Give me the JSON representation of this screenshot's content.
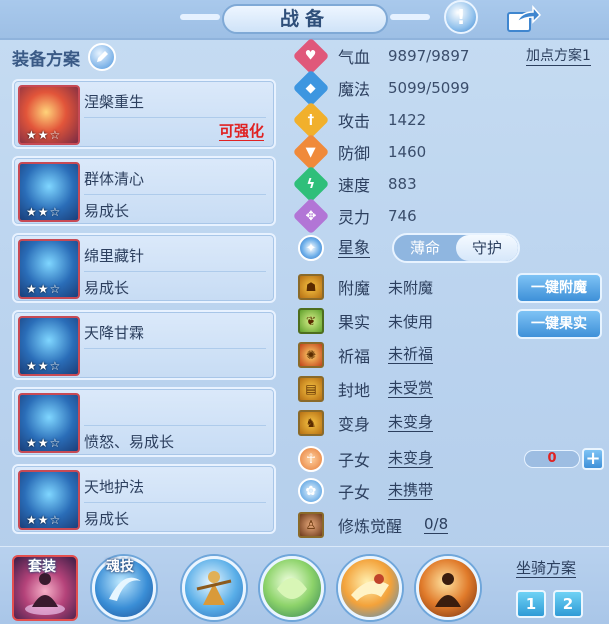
{
  "header": {
    "title": "战备",
    "info_glyph": "!",
    "share_icon": "share-icon"
  },
  "left": {
    "heading": "装备方案",
    "equipment": [
      {
        "name": "涅槃重生",
        "trait": "",
        "strength_label": "可强化",
        "stars": "★★☆",
        "icon": "rocket-item-icon"
      },
      {
        "name": "群体清心",
        "trait": "易成长",
        "strength_label": "",
        "stars": "★★☆",
        "icon": "blue-mask-icon"
      },
      {
        "name": "绵里藏针",
        "trait": "易成长",
        "strength_label": "",
        "stars": "★★☆",
        "icon": "blue-mask-icon"
      },
      {
        "name": "天降甘霖",
        "trait": "",
        "strength_label": "",
        "stars": "★★☆",
        "icon": "blue-mask-icon"
      },
      {
        "name": "",
        "trait": "愤怒、易成长",
        "strength_label": "",
        "stars": "★★☆",
        "icon": "blue-mask-icon"
      },
      {
        "name": "天地护法",
        "trait": "易成长",
        "strength_label": "",
        "stars": "★★☆",
        "icon": "blue-mask-icon"
      }
    ]
  },
  "stats": {
    "plan_link": "加点方案1",
    "rows": [
      {
        "label": "气血",
        "value": "9897/9897",
        "icon": "heart-icon",
        "color": "#e0587a"
      },
      {
        "label": "魔法",
        "value": "5099/5099",
        "icon": "mana-icon",
        "color": "#3d96e0"
      },
      {
        "label": "攻击",
        "value": "1422",
        "icon": "sword-icon",
        "color": "#f1b02c"
      },
      {
        "label": "防御",
        "value": "1460",
        "icon": "shield-icon",
        "color": "#f08a3a"
      },
      {
        "label": "速度",
        "value": "883",
        "icon": "lightning-icon",
        "color": "#2fbf7a"
      },
      {
        "label": "灵力",
        "value": "746",
        "icon": "spirit-icon",
        "color": "#b275d6"
      }
    ],
    "star_sign": {
      "label": "星象",
      "options": [
        "薄命",
        "守护"
      ],
      "active": 1
    }
  },
  "extras": {
    "rows": [
      {
        "label": "附魔",
        "value": "未附魔",
        "underline": false,
        "icon": "enchant-icon"
      },
      {
        "label": "果实",
        "value": "未使用",
        "underline": false,
        "icon": "fruit-icon"
      },
      {
        "label": "祈福",
        "value": "未祈福",
        "underline": true,
        "icon": "blessing-icon"
      },
      {
        "label": "封地",
        "value": "未受赏",
        "underline": true,
        "icon": "fief-icon"
      },
      {
        "label": "变身",
        "value": "未变身",
        "underline": true,
        "icon": "transform-icon"
      },
      {
        "label": "子女",
        "value": "未变身",
        "underline": true,
        "icon": "child-icon"
      },
      {
        "label": "子女",
        "value": "未携带",
        "underline": true,
        "icon": "paw-icon"
      },
      {
        "label": "修炼觉醒",
        "value": "0/8",
        "underline": true,
        "icon": "cultivate-icon"
      }
    ],
    "btn_enchant": "一键附魔",
    "btn_fruit": "一键果实",
    "counter_value": "0",
    "counter_plus": "+"
  },
  "bottom": {
    "set_label": "套装",
    "soul_label": "魂技",
    "mount_label": "坐骑方案",
    "mount_buttons": [
      "1",
      "2"
    ]
  }
}
